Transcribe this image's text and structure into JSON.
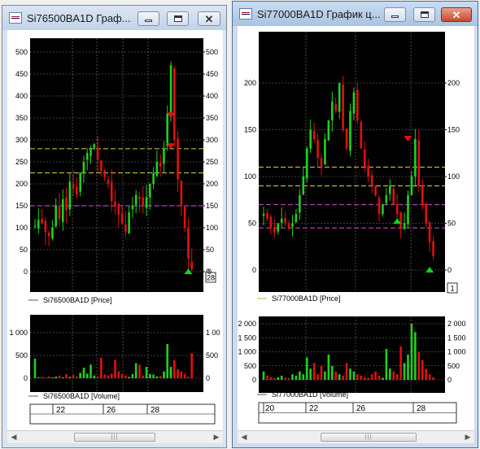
{
  "windows": [
    {
      "title": "Si76500BA1D Граф...",
      "price_legend": "Si76500BA1D [Price]",
      "volume_legend": "Si76500BA1D [Volume]",
      "price_ticks": [
        "0",
        "50",
        "100",
        "150",
        "200",
        "250",
        "300",
        "350",
        "400",
        "450",
        "500"
      ],
      "right_price_ticks": [
        "0",
        "50",
        "100",
        "150",
        "200",
        "250",
        "300",
        "350",
        "400",
        "450",
        "500"
      ],
      "price_badge": "28",
      "volume_ticks": [
        "0",
        "500",
        "1 000"
      ],
      "right_volume_ticks": [
        "0",
        "500",
        "1 00"
      ],
      "date_ticks": [
        "22",
        "26",
        "28"
      ],
      "price_marker_label": "0"
    },
    {
      "title": "Si77000BA1D График ц...",
      "price_legend": "Si77000BA1D [Price]",
      "volume_legend": "Si77000BA1D [Volume]",
      "price_ticks": [
        "0",
        "50",
        "100",
        "150",
        "200"
      ],
      "right_price_ticks": [
        "0",
        "50",
        "100",
        "150",
        "200"
      ],
      "price_badge": "1",
      "volume_ticks": [
        "0",
        "500",
        "1 000",
        "1 500",
        "2 000"
      ],
      "right_volume_ticks": [
        "0",
        "500",
        "1 000",
        "1 500",
        "2 000"
      ],
      "date_ticks": [
        "20",
        "22",
        "26",
        "28"
      ]
    }
  ],
  "colors": {
    "background": "#000000",
    "up_candle": "#1fd11f",
    "down_candle": "#e01010",
    "grid": "#7d7d7d",
    "level_yellow": "#b8b840",
    "level_magenta": "#b040b0",
    "signal_sell": "#e01010",
    "signal_buy": "#14d214"
  },
  "chart_data": [
    {
      "type": "candlestick",
      "title": "Si76500BA1D",
      "series": [
        {
          "name": "Si76500BA1D [Price]",
          "ylim": [
            0,
            500
          ]
        },
        {
          "name": "Si76500BA1D [Volume]",
          "ylim": [
            0,
            1000
          ]
        }
      ],
      "x": [
        "22",
        "26",
        "28"
      ],
      "levels": [
        {
          "value": 280,
          "color": "yellow"
        },
        {
          "value": 225,
          "color": "yellow"
        },
        {
          "value": 150,
          "color": "magenta"
        }
      ],
      "signals": [
        {
          "type": "sell",
          "value": 355
        },
        {
          "type": "sell",
          "value": 285
        },
        {
          "type": "buy",
          "value": 0
        }
      ]
    },
    {
      "type": "candlestick",
      "title": "Si77000BA1D",
      "series": [
        {
          "name": "Si77000BA1D [Price]",
          "ylim": [
            0,
            200
          ]
        },
        {
          "name": "Si77000BA1D [Volume]",
          "ylim": [
            0,
            2000
          ]
        }
      ],
      "x": [
        "20",
        "22",
        "26",
        "28"
      ],
      "levels": [
        {
          "value": 110,
          "color": "yellow"
        },
        {
          "value": 90,
          "color": "yellow"
        },
        {
          "value": 70,
          "color": "magenta"
        },
        {
          "value": 45,
          "color": "magenta"
        }
      ],
      "signals": [
        {
          "type": "buy",
          "value": 52
        },
        {
          "type": "sell",
          "value": 140
        },
        {
          "type": "buy",
          "value": 0
        }
      ]
    }
  ]
}
